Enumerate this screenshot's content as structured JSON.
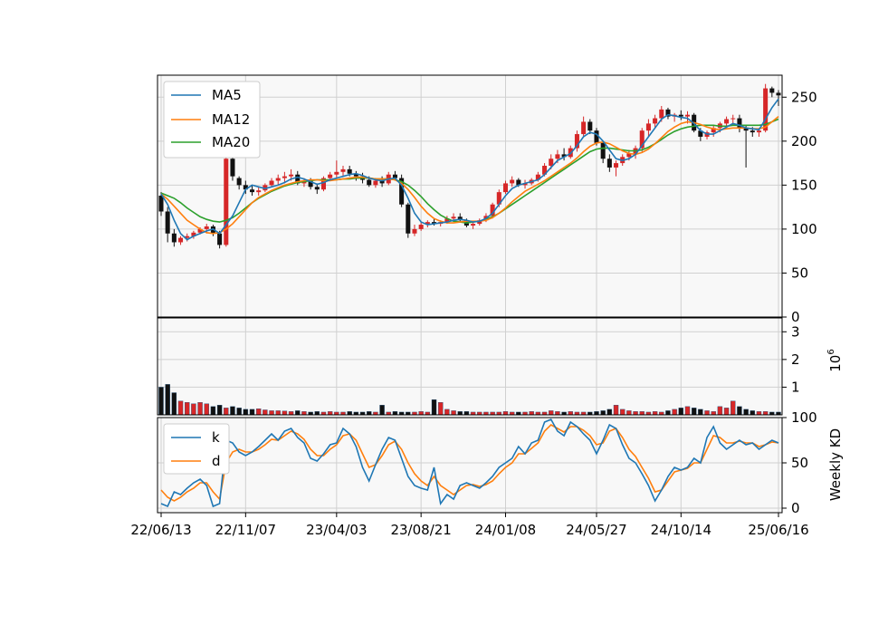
{
  "chart_data": [
    {
      "type": "candlestick",
      "title": "",
      "ylim": [
        0,
        275
      ],
      "yticks": [
        "0",
        "50",
        "100",
        "150",
        "200",
        "250"
      ],
      "grid": true,
      "legend_position": "top-left",
      "legend": [
        "MA5",
        "MA12",
        "MA20"
      ],
      "colors": {
        "up": "#d62728",
        "down": "#111111",
        "MA5": "#1f77b4",
        "MA12": "#ff7f0e",
        "MA20": "#2ca02c",
        "grid": "#d0d0d0",
        "bg": "#f8f8f8"
      },
      "ohlc": [
        [
          138,
          142,
          115,
          120
        ],
        [
          120,
          125,
          85,
          95
        ],
        [
          95,
          100,
          80,
          85
        ],
        [
          85,
          92,
          82,
          90
        ],
        [
          90,
          95,
          86,
          92
        ],
        [
          92,
          98,
          89,
          96
        ],
        [
          96,
          102,
          94,
          100
        ],
        [
          100,
          106,
          95,
          103
        ],
        [
          103,
          105,
          92,
          95
        ],
        [
          95,
          98,
          78,
          82
        ],
        [
          82,
          185,
          80,
          180
        ],
        [
          180,
          182,
          155,
          160
        ],
        [
          158,
          160,
          145,
          150
        ],
        [
          150,
          155,
          140,
          145
        ],
        [
          145,
          150,
          138,
          142
        ],
        [
          142,
          148,
          138,
          144
        ],
        [
          144,
          152,
          142,
          150
        ],
        [
          150,
          158,
          148,
          155
        ],
        [
          155,
          162,
          150,
          158
        ],
        [
          158,
          165,
          152,
          160
        ],
        [
          160,
          168,
          155,
          162
        ],
        [
          162,
          166,
          150,
          152
        ],
        [
          152,
          158,
          148,
          155
        ],
        [
          155,
          158,
          145,
          148
        ],
        [
          148,
          152,
          140,
          145
        ],
        [
          145,
          160,
          143,
          158
        ],
        [
          158,
          165,
          155,
          162
        ],
        [
          162,
          178,
          158,
          165
        ],
        [
          165,
          172,
          160,
          168
        ],
        [
          168,
          172,
          160,
          163
        ],
        [
          163,
          166,
          155,
          160
        ],
        [
          160,
          164,
          152,
          156
        ],
        [
          156,
          160,
          148,
          150
        ],
        [
          150,
          158,
          147,
          155
        ],
        [
          155,
          160,
          148,
          152
        ],
        [
          152,
          165,
          150,
          162
        ],
        [
          162,
          166,
          155,
          158
        ],
        [
          158,
          162,
          125,
          128
        ],
        [
          128,
          130,
          90,
          95
        ],
        [
          95,
          105,
          92,
          100
        ],
        [
          100,
          108,
          98,
          105
        ],
        [
          105,
          110,
          102,
          108
        ],
        [
          108,
          112,
          104,
          106
        ],
        [
          106,
          110,
          103,
          108
        ],
        [
          108,
          115,
          106,
          112
        ],
        [
          112,
          118,
          108,
          114
        ],
        [
          114,
          118,
          108,
          110
        ],
        [
          110,
          112,
          102,
          104
        ],
        [
          104,
          108,
          100,
          106
        ],
        [
          106,
          112,
          104,
          110
        ],
        [
          110,
          118,
          108,
          115
        ],
        [
          115,
          130,
          112,
          128
        ],
        [
          128,
          145,
          125,
          142
        ],
        [
          142,
          155,
          140,
          152
        ],
        [
          152,
          160,
          148,
          156
        ],
        [
          156,
          158,
          148,
          150
        ],
        [
          150,
          156,
          146,
          152
        ],
        [
          152,
          158,
          150,
          156
        ],
        [
          156,
          165,
          154,
          162
        ],
        [
          162,
          175,
          160,
          172
        ],
        [
          172,
          185,
          168,
          180
        ],
        [
          180,
          190,
          175,
          185
        ],
        [
          185,
          192,
          178,
          182
        ],
        [
          182,
          195,
          180,
          192
        ],
        [
          192,
          212,
          188,
          208
        ],
        [
          208,
          228,
          205,
          222
        ],
        [
          222,
          225,
          208,
          212
        ],
        [
          212,
          215,
          195,
          198
        ],
        [
          198,
          200,
          175,
          180
        ],
        [
          180,
          185,
          165,
          170
        ],
        [
          170,
          178,
          160,
          175
        ],
        [
          175,
          185,
          172,
          182
        ],
        [
          182,
          190,
          178,
          186
        ],
        [
          186,
          195,
          180,
          192
        ],
        [
          192,
          215,
          188,
          212
        ],
        [
          212,
          225,
          205,
          220
        ],
        [
          220,
          230,
          215,
          226
        ],
        [
          226,
          240,
          222,
          236
        ],
        [
          236,
          238,
          225,
          228
        ],
        [
          228,
          232,
          222,
          230
        ],
        [
          230,
          235,
          224,
          228
        ],
        [
          228,
          234,
          220,
          230
        ],
        [
          230,
          232,
          210,
          212
        ],
        [
          212,
          215,
          200,
          205
        ],
        [
          205,
          212,
          202,
          210
        ],
        [
          210,
          218,
          205,
          215
        ],
        [
          215,
          222,
          210,
          220
        ],
        [
          220,
          228,
          215,
          225
        ],
        [
          225,
          230,
          218,
          226
        ],
        [
          226,
          230,
          210,
          215
        ],
        [
          215,
          218,
          170,
          212
        ],
        [
          212,
          216,
          205,
          210
        ],
        [
          210,
          215,
          205,
          212
        ],
        [
          212,
          265,
          210,
          260
        ],
        [
          260,
          262,
          250,
          255
        ],
        [
          255,
          258,
          240,
          252
        ]
      ],
      "MA5": [
        140,
        128,
        110,
        95,
        88,
        92,
        95,
        98,
        100,
        95,
        105,
        115,
        130,
        145,
        150,
        148,
        146,
        148,
        150,
        153,
        157,
        159,
        157,
        154,
        151,
        153,
        156,
        158,
        160,
        162,
        163,
        161,
        158,
        156,
        155,
        157,
        158,
        150,
        135,
        118,
        108,
        105,
        106,
        107,
        108,
        110,
        111,
        110,
        108,
        109,
        112,
        118,
        128,
        138,
        146,
        150,
        152,
        154,
        156,
        162,
        170,
        178,
        182,
        186,
        195,
        205,
        210,
        208,
        200,
        190,
        180,
        178,
        180,
        185,
        195,
        205,
        215,
        225,
        230,
        229,
        227,
        226,
        220,
        212,
        208,
        208,
        212,
        216,
        220,
        218,
        215,
        214,
        213,
        225,
        238,
        248
      ],
      "MA12": [
        140,
        134,
        126,
        118,
        110,
        105,
        100,
        96,
        95,
        96,
        100,
        106,
        114,
        122,
        130,
        136,
        140,
        144,
        147,
        150,
        152,
        154,
        155,
        156,
        156,
        155,
        155,
        156,
        157,
        158,
        159,
        159,
        158,
        157,
        157,
        157,
        156,
        152,
        145,
        136,
        126,
        118,
        112,
        109,
        107,
        107,
        108,
        109,
        109,
        109,
        110,
        113,
        118,
        124,
        131,
        137,
        143,
        147,
        151,
        155,
        160,
        165,
        170,
        175,
        181,
        188,
        194,
        198,
        199,
        197,
        193,
        189,
        186,
        185,
        187,
        191,
        197,
        204,
        211,
        216,
        220,
        222,
        221,
        219,
        216,
        214,
        213,
        214,
        215,
        215,
        215,
        214,
        214,
        216,
        222,
        228
      ],
      "MA20": [
        141,
        138,
        135,
        130,
        124,
        119,
        114,
        111,
        109,
        108,
        110,
        113,
        118,
        124,
        130,
        135,
        139,
        143,
        146,
        149,
        151,
        153,
        154,
        155,
        156,
        156,
        156,
        156,
        157,
        157,
        158,
        158,
        158,
        157,
        157,
        157,
        156,
        154,
        150,
        144,
        137,
        129,
        122,
        116,
        112,
        109,
        108,
        107,
        108,
        109,
        111,
        114,
        118,
        123,
        128,
        133,
        138,
        143,
        148,
        153,
        158,
        163,
        168,
        173,
        178,
        183,
        188,
        191,
        192,
        192,
        191,
        190,
        189,
        189,
        190,
        193,
        197,
        202,
        207,
        211,
        214,
        216,
        217,
        218,
        218,
        218,
        217,
        217,
        218,
        218,
        218,
        218,
        218,
        219,
        222,
        225
      ],
      "xticks": [
        "22/06/13",
        "22/11/07",
        "23/04/03",
        "23/08/21",
        "24/01/08",
        "24/05/27",
        "24/10/14",
        "25/06/16"
      ]
    },
    {
      "type": "bar",
      "ylabel": "10",
      "ylabel_exponent": "6",
      "ylim": [
        0,
        3.5
      ],
      "yticks": [
        "1",
        "2",
        "3"
      ],
      "values": [
        1.0,
        1.1,
        0.8,
        0.5,
        0.45,
        0.4,
        0.45,
        0.4,
        0.3,
        0.35,
        0.25,
        0.3,
        0.25,
        0.2,
        0.2,
        0.22,
        0.18,
        0.15,
        0.15,
        0.14,
        0.12,
        0.15,
        0.12,
        0.1,
        0.12,
        0.1,
        0.12,
        0.1,
        0.1,
        0.12,
        0.1,
        0.1,
        0.12,
        0.1,
        0.35,
        0.1,
        0.12,
        0.1,
        0.1,
        0.1,
        0.12,
        0.1,
        0.55,
        0.45,
        0.2,
        0.15,
        0.12,
        0.12,
        0.1,
        0.1,
        0.1,
        0.1,
        0.1,
        0.12,
        0.1,
        0.1,
        0.1,
        0.12,
        0.1,
        0.1,
        0.15,
        0.12,
        0.1,
        0.12,
        0.1,
        0.1,
        0.1,
        0.12,
        0.15,
        0.2,
        0.35,
        0.2,
        0.15,
        0.12,
        0.12,
        0.1,
        0.12,
        0.1,
        0.15,
        0.2,
        0.25,
        0.3,
        0.25,
        0.2,
        0.15,
        0.12,
        0.3,
        0.25,
        0.5,
        0.3,
        0.2,
        0.15,
        0.12,
        0.12,
        0.1,
        0.1
      ]
    },
    {
      "type": "line",
      "ylabel": "Weekly KD",
      "ylim": [
        -5,
        100
      ],
      "yticks": [
        "0",
        "50",
        "100"
      ],
      "legend": [
        "k",
        "d"
      ],
      "legend_position": "top-left",
      "series": [
        {
          "name": "k",
          "values": [
            5,
            2,
            18,
            15,
            22,
            28,
            32,
            25,
            2,
            5,
            75,
            72,
            62,
            58,
            62,
            68,
            75,
            82,
            75,
            85,
            88,
            78,
            72,
            55,
            52,
            60,
            70,
            72,
            88,
            82,
            68,
            45,
            30,
            48,
            65,
            78,
            75,
            55,
            35,
            25,
            22,
            20,
            45,
            5,
            15,
            10,
            25,
            28,
            25,
            22,
            28,
            35,
            45,
            50,
            55,
            68,
            60,
            72,
            75,
            95,
            98,
            85,
            80,
            95,
            90,
            82,
            75,
            60,
            75,
            92,
            88,
            70,
            55,
            50,
            38,
            25,
            8,
            20,
            35,
            45,
            42,
            45,
            55,
            50,
            78,
            90,
            72,
            65,
            70,
            75,
            70,
            72,
            65,
            70,
            75,
            72
          ]
        },
        {
          "name": "d",
          "values": [
            20,
            12,
            8,
            12,
            18,
            22,
            28,
            28,
            18,
            10,
            50,
            62,
            65,
            62,
            62,
            65,
            70,
            76,
            75,
            80,
            85,
            82,
            76,
            65,
            58,
            58,
            65,
            70,
            80,
            82,
            75,
            60,
            45,
            48,
            58,
            70,
            74,
            65,
            50,
            38,
            30,
            25,
            35,
            25,
            20,
            15,
            20,
            25,
            26,
            24,
            26,
            30,
            38,
            45,
            50,
            60,
            60,
            66,
            72,
            85,
            92,
            88,
            84,
            90,
            90,
            86,
            80,
            70,
            72,
            85,
            88,
            78,
            65,
            57,
            45,
            33,
            18,
            20,
            30,
            40,
            42,
            44,
            50,
            50,
            65,
            80,
            78,
            72,
            72,
            74,
            72,
            72,
            68,
            70,
            73,
            72
          ]
        }
      ]
    }
  ]
}
